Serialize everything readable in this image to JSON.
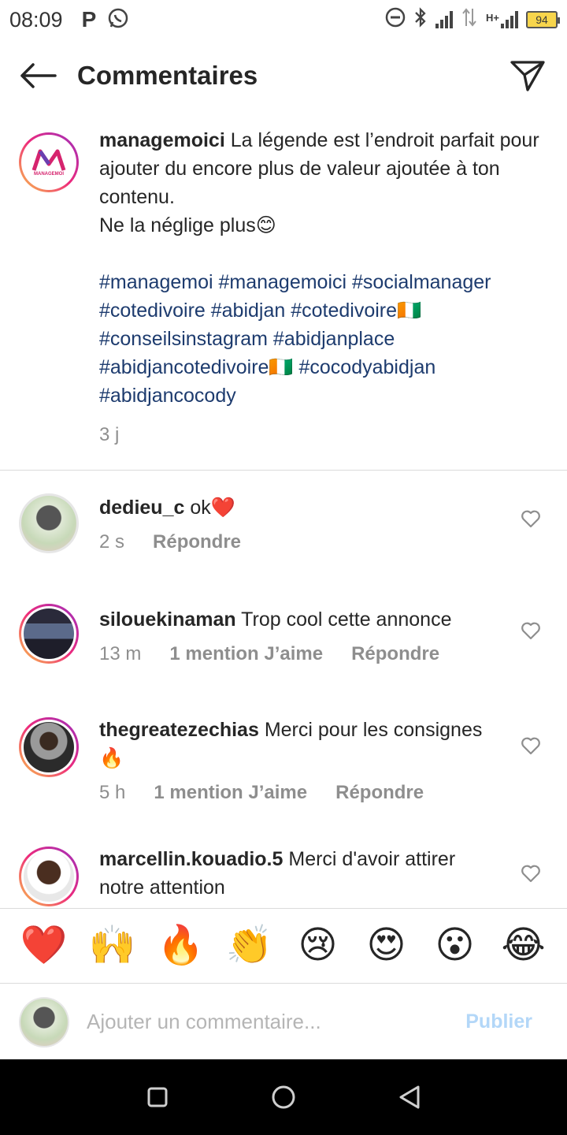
{
  "status_bar": {
    "time": "08:09",
    "battery": "94",
    "network": "H+"
  },
  "header": {
    "title": "Commentaires"
  },
  "caption": {
    "username": "managemoici",
    "text_line1": "La légende est l’endroit parfait pour ajouter du encore plus de valeur ajoutée à ton contenu.",
    "text_line2": "Ne la néglige plus😊",
    "hashtags": "#managemoi #managemoici #socialmanager #cotedivoire #abidjan #cotedivoire🇨🇮 #conseilsinstagram #abidjanplace #abidjancotedivoire🇨🇮 #cocodyabidjan #abidjancocody",
    "time": "3 j",
    "avatar_text": "MANAGEMOI"
  },
  "comments": [
    {
      "username": "dedieu_c",
      "text": "ok❤️",
      "time": "2 s",
      "likes": "",
      "reply": "Répondre"
    },
    {
      "username": "silouekinaman",
      "text": "Trop cool cette annonce",
      "time": "13 m",
      "likes": "1 mention J’aime",
      "reply": "Répondre"
    },
    {
      "username": "thegreatezechias",
      "text": "Merci pour les consignes 🔥",
      "time": "5 h",
      "likes": "1 mention J’aime",
      "reply": "Répondre"
    },
    {
      "username": "marcellin.kouadio.5",
      "text": "Merci d'avoir attirer notre attention",
      "time": "",
      "likes": "",
      "reply": ""
    }
  ],
  "emoji_bar": [
    "❤️",
    "🙌",
    "🔥",
    "👏",
    "😢",
    "😍",
    "😮",
    "😂"
  ],
  "input": {
    "placeholder": "Ajouter un commentaire...",
    "publish_label": "Publier"
  },
  "colors": {
    "hashtag": "#1d3b6e",
    "meta_gray": "#8e8e8e",
    "publish_disabled": "#b3d7f8",
    "divider": "#dbdbdb"
  }
}
